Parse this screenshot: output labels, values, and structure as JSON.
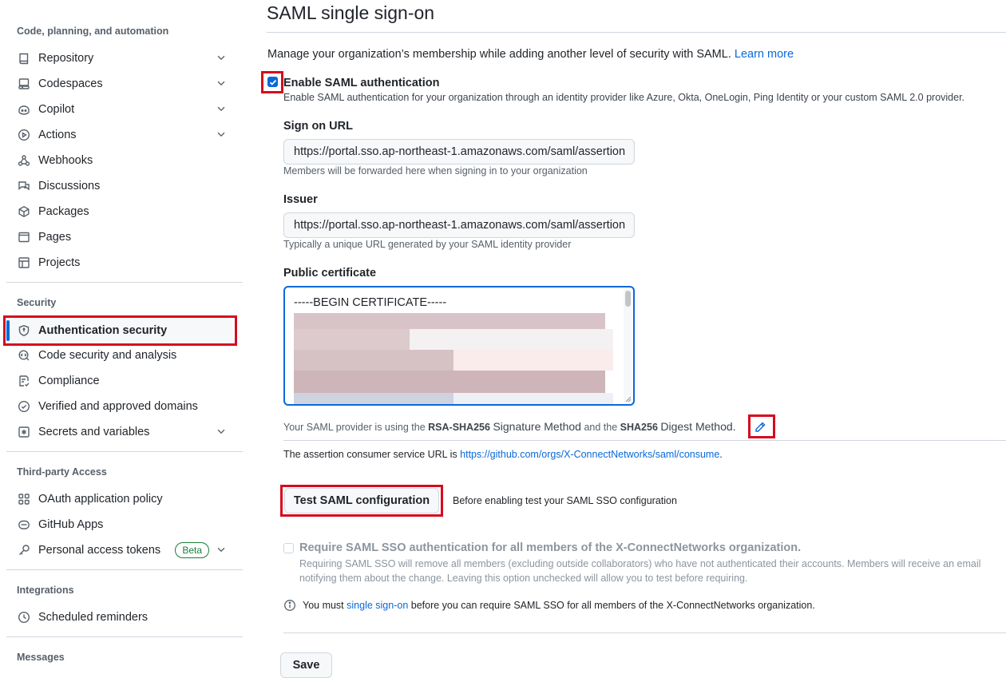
{
  "sidebar": {
    "groups": {
      "code": "Code, planning, and automation",
      "security": "Security",
      "third_party": "Third-party Access",
      "integrations": "Integrations",
      "messages": "Messages"
    },
    "items": {
      "repository": "Repository",
      "codespaces": "Codespaces",
      "copilot": "Copilot",
      "actions": "Actions",
      "webhooks": "Webhooks",
      "discussions": "Discussions",
      "packages": "Packages",
      "pages": "Pages",
      "projects": "Projects",
      "auth_security": "Authentication security",
      "code_security": "Code security and analysis",
      "compliance": "Compliance",
      "domains": "Verified and approved domains",
      "secrets": "Secrets and variables",
      "oauth": "OAuth application policy",
      "github_apps": "GitHub Apps",
      "pat": "Personal access tokens",
      "pat_badge": "Beta",
      "scheduled": "Scheduled reminders"
    }
  },
  "main": {
    "title": "SAML single sign-on",
    "intro": "Manage your organization’s membership while adding another level of security with SAML.",
    "learn_more": "Learn more",
    "enable": {
      "label": "Enable SAML authentication",
      "desc": "Enable SAML authentication for your organization through an identity provider like Azure, Okta, OneLogin, Ping Identity or your custom SAML 2.0 provider.",
      "checked": true
    },
    "sign_on_url": {
      "label": "Sign on URL",
      "value": "https://portal.sso.ap-northeast-1.amazonaws.com/saml/assertion",
      "note": "Members will be forwarded here when signing in to your organization"
    },
    "issuer": {
      "label": "Issuer",
      "value": "https://portal.sso.ap-northeast-1.amazonaws.com/saml/assertion",
      "note": "Typically a unique URL generated by your SAML identity provider"
    },
    "certificate": {
      "label": "Public certificate",
      "begin": "-----BEGIN CERTIFICATE-----"
    },
    "signature": {
      "prefix": "Your SAML provider is using the",
      "sig_method": "RSA-SHA256",
      "sig_text": "Signature Method",
      "and_the": "and the",
      "digest_method": "SHA256",
      "digest_text": "Digest Method."
    },
    "acs": {
      "prefix": "The assertion consumer service URL is",
      "url": "https://github.com/orgs/X-ConnectNetworks/saml/consume",
      "suffix": "."
    },
    "test_button": "Test SAML configuration",
    "test_note": "Before enabling test your SAML SSO configuration",
    "require": {
      "label": "Require SAML SSO authentication for all members of the X-ConnectNetworks organization.",
      "desc": "Requiring SAML SSO will remove all members (excluding outside collaborators) who have not authenticated their accounts. Members will receive an email notifying them about the change. Leaving this option unchecked will allow you to test before requiring."
    },
    "info": {
      "prefix": "You must",
      "link": "single sign-on",
      "suffix": "before you can require SAML SSO for all members of the X-ConnectNetworks organization."
    },
    "save_button": "Save"
  },
  "colors": {
    "accent": "#0969da",
    "highlight": "#d60a1e",
    "beta": "#1a7f37"
  },
  "icons": [
    "repo-icon",
    "codespaces-icon",
    "copilot-icon",
    "play-icon",
    "webhook-icon",
    "comment-discussion-icon",
    "package-icon",
    "browser-icon",
    "table-icon",
    "shield-lock-icon",
    "codescan-icon",
    "checklist-icon",
    "verified-icon",
    "asterisk-icon",
    "apps-icon",
    "hubot-icon",
    "key-icon",
    "clock-icon",
    "chevron-down-icon",
    "pencil-icon",
    "info-icon",
    "check-icon"
  ]
}
